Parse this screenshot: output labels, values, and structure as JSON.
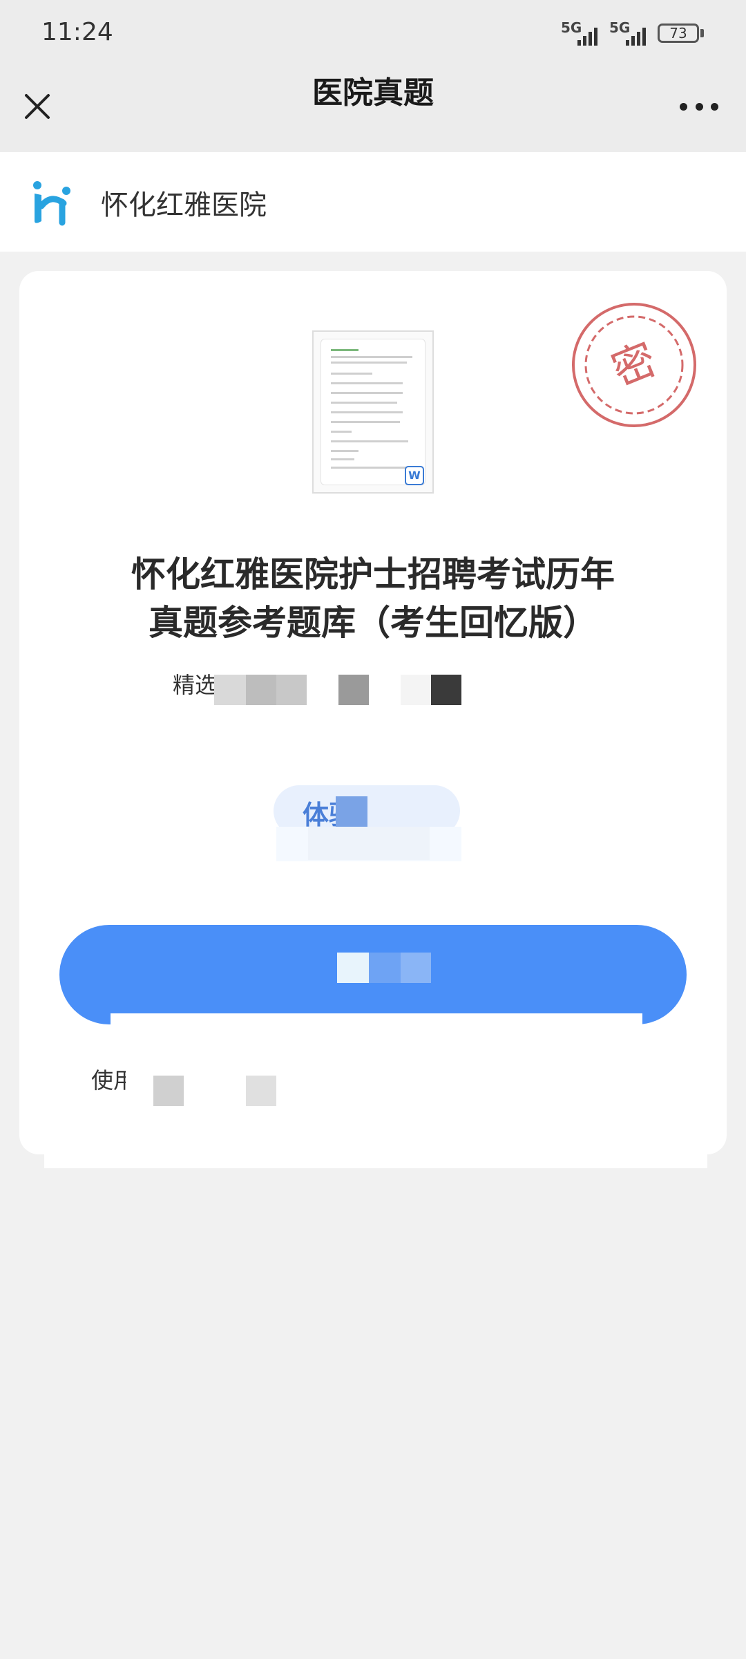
{
  "status_bar": {
    "time": "11:24",
    "signal_1_label": "5G",
    "signal_2_label": "5G",
    "battery": "73"
  },
  "nav": {
    "title": "医院真题",
    "close_icon": "close-icon",
    "more_icon": "more-icon"
  },
  "hospital": {
    "name": "怀化红雅医院"
  },
  "card": {
    "title_line1": "怀化红雅医院护士招聘考试历年",
    "title_line2": "真题参考题库（考生回忆版）",
    "subtitle_prefix": "精选",
    "trial_label": "体验",
    "buy_label": "",
    "usage_prefix": "使用",
    "stamp_char": "密",
    "doc_badge": "W"
  },
  "colors": {
    "accent": "#4a8ff8",
    "stamp": "#d46a6a",
    "trial_bg": "#e8f0fd"
  }
}
